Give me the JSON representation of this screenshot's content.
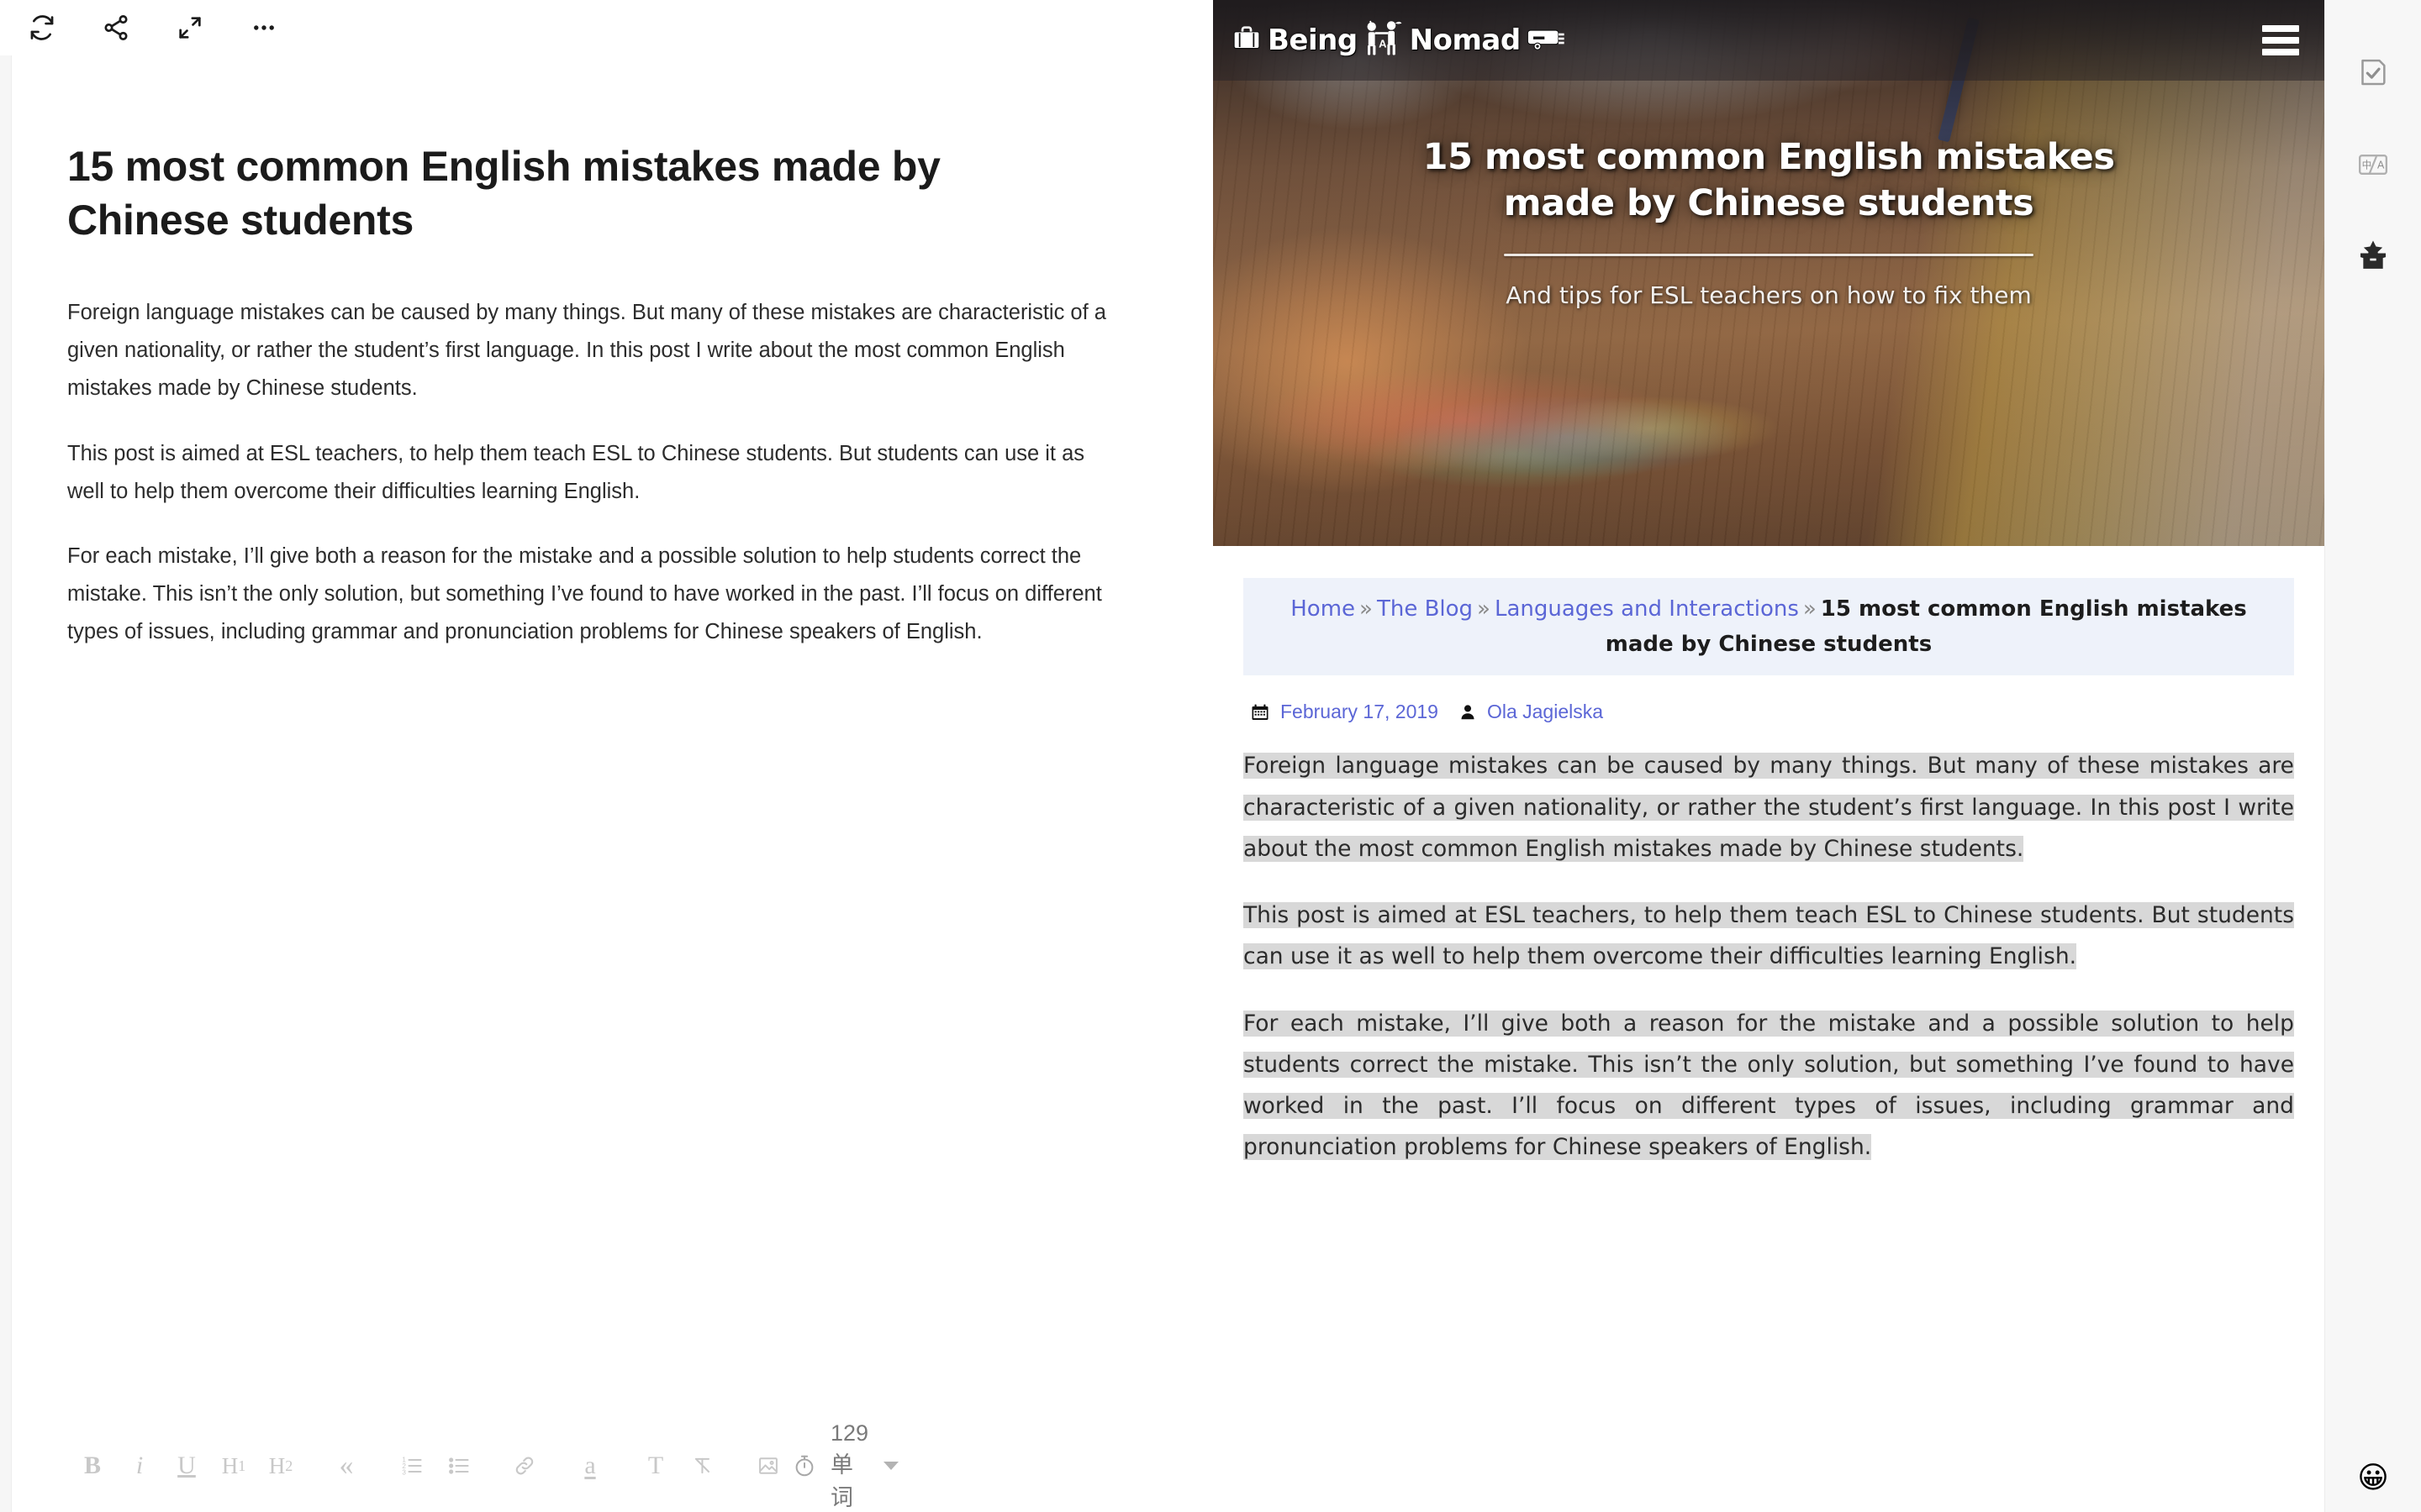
{
  "editor": {
    "toolbar_top": [
      {
        "name": "sync-icon",
        "label": "Sync"
      },
      {
        "name": "share-icon",
        "label": "Share"
      },
      {
        "name": "fullscreen-icon",
        "label": "Fullscreen"
      },
      {
        "name": "more-icon",
        "label": "More"
      }
    ],
    "title": "15 most common English mistakes made by Chinese students",
    "paragraphs": [
      "Foreign language mistakes can be caused by many things. But many of these mistakes are characteristic of a given nationality, or rather the student’s first language. In this post I write about the most common English mistakes made by Chinese students.",
      "This post is aimed at ESL teachers, to help them teach ESL to Chinese students. But students can use it as well to help them overcome their difficulties learning English.",
      "For each mistake, I’ll give both a reason for the mistake and a possible solution to help students correct the mistake. This isn’t the only solution, but something I’ve found to have worked in the past. I’ll focus on different types of issues, including grammar and pronunciation problems for Chinese speakers of English."
    ],
    "format_buttons": [
      {
        "name": "bold-button",
        "label": "B"
      },
      {
        "name": "italic-button",
        "label": "i"
      },
      {
        "name": "underline-button",
        "label": "U"
      },
      {
        "name": "heading-1-button",
        "label": "H1"
      },
      {
        "name": "heading-2-button",
        "label": "H2"
      },
      {
        "name": "blockquote-button",
        "label": "«"
      },
      {
        "name": "ordered-list-button",
        "label": "ordered-list"
      },
      {
        "name": "unordered-list-button",
        "label": "unordered-list"
      },
      {
        "name": "link-button",
        "label": "link"
      },
      {
        "name": "highlight-button",
        "label": "a"
      },
      {
        "name": "text-color-button",
        "label": "T"
      },
      {
        "name": "clear-format-button",
        "label": "clear"
      },
      {
        "name": "insert-image-button",
        "label": "image"
      }
    ],
    "word_count": "129 单词"
  },
  "web": {
    "site_name": "Being A Nomad",
    "logo_word_1": "Being",
    "logo_middle": "A",
    "logo_word_2": "Nomad",
    "menu_label": "Menu",
    "hero": {
      "title_line_1": "15 most common English mistakes",
      "title_line_2": "made by Chinese students",
      "subtitle": "And tips for ESL teachers on how to fix them"
    },
    "breadcrumb": {
      "items": [
        "Home",
        "The Blog",
        "Languages and Interactions"
      ],
      "separator": "»",
      "current": "15 most common English mistakes made by Chinese students"
    },
    "meta": {
      "date": "February 17, 2019",
      "author": "Ola Jagielska",
      "date_icon": "calendar-icon",
      "author_icon": "user-icon"
    },
    "paragraphs": [
      "Foreign language mistakes can be caused by many things. But many of these mistakes are characteristic of a given nationality, or rather the student’s first language. In this post I write about the most common English mistakes made by Chinese students.",
      "This post is aimed at ESL teachers, to help them teach ESL to Chinese students. But students can use it as well to help them overcome their difficulties learning English.",
      "For each mistake, I’ll give both a reason for the mistake and a possible solution to help students correct the mistake. This isn’t the only solution, but something I’ve found to have worked in the past. I’ll focus on different types of issues, including grammar and pronunciation problems for Chinese speakers of English."
    ]
  },
  "right_rail": {
    "items": [
      {
        "name": "document-check-icon",
        "label": "Proofread"
      },
      {
        "name": "translate-icon",
        "label": "Translate"
      },
      {
        "name": "collect-box-icon",
        "label": "Collect"
      }
    ],
    "emoji": "😀"
  },
  "colors": {
    "accent_link": "#5b66d6",
    "breadcrumb_bg": "#eef2fa",
    "selection_bg": "#d8d8d8",
    "rail_bg": "#f7f7f7",
    "header_dark": "#262327"
  }
}
